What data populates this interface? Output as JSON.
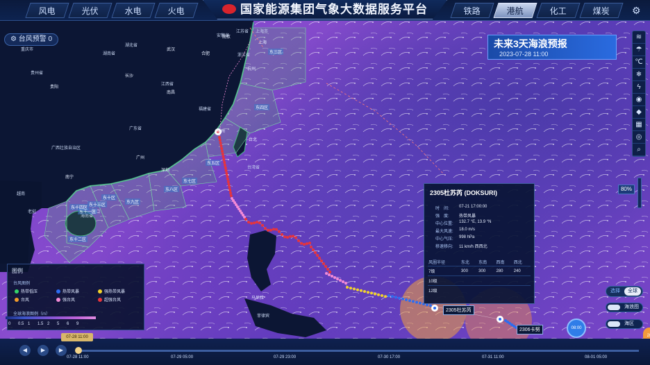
{
  "app": {
    "title": "国家能源集团气象大数据服务平台",
    "left_tabs": [
      "风电",
      "光伏",
      "水电",
      "火电"
    ],
    "right_tabs": [
      "铁路",
      "港航",
      "化工",
      "煤炭"
    ],
    "active_tab": "港航"
  },
  "alerts": {
    "typhoon_warning": "台风预警 0"
  },
  "forecast": {
    "title": "未来3天海浪预报",
    "time": "2023-07-28 11:00"
  },
  "toolbar": {
    "icons": [
      "wind-icon",
      "rain-icon",
      "temperature-icon",
      "snow-icon",
      "lightning-icon",
      "fire-icon",
      "layers-icon",
      "grid-icon",
      "target-icon",
      "search-icon"
    ],
    "zoom_label": "80%"
  },
  "map_labels": {
    "provinces": [
      "重庆市",
      "贵州省",
      "湖南省",
      "湖北省",
      "江西省",
      "广西壮族自治区",
      "广东省",
      "福建省",
      "浙江省",
      "海南省",
      "安徽省",
      "江苏省",
      "上海市",
      "台湾省"
    ],
    "cities": [
      "贵阳",
      "长沙",
      "南昌",
      "福州",
      "台北",
      "广州",
      "深圳",
      "南宁",
      "海口",
      "杭州",
      "合肥",
      "南京",
      "上海",
      "武汉",
      "马尼拉"
    ],
    "countries": [
      "越南",
      "老挝",
      "菲律宾"
    ],
    "sea_zones": [
      "东三区",
      "东四区",
      "东五区",
      "东七区",
      "东八区",
      "东九区",
      "东十区",
      "东十一区",
      "东十二区",
      "东十三区",
      "东十四区"
    ]
  },
  "typhoon_card": {
    "title": "2305杜苏芮 (DOKSURI)",
    "rows": [
      {
        "label": "时　间:",
        "value": "07-21 17:00:00"
      },
      {
        "label": "强　度:",
        "value": "热带风暴"
      },
      {
        "label": "中心位置:",
        "value": "132.7 °E, 13.9 °N"
      },
      {
        "label": "最大风速:",
        "value": "18.0 m/s"
      },
      {
        "label": "中心气压:",
        "value": "998 hPa"
      },
      {
        "label": "移速移向:",
        "value": "11 km/h 西西北"
      }
    ],
    "wind_table": {
      "headers": [
        "风圈半径",
        "东北",
        "东南",
        "西南",
        "西北"
      ],
      "rows": [
        [
          "7级",
          "300",
          "300",
          "280",
          "240"
        ],
        [
          "10级",
          "",
          "",
          "",
          ""
        ],
        [
          "12级",
          "",
          "",
          "",
          ""
        ]
      ]
    }
  },
  "typhoon_labels": {
    "primary": "2305杜苏芮",
    "secondary": "2306卡努"
  },
  "legend": {
    "title": "图例",
    "section1": "台风图例",
    "items": [
      {
        "label": "热带低压",
        "color": "#34d36a"
      },
      {
        "label": "热带风暴",
        "color": "#2d6cf0"
      },
      {
        "label": "强热带风暴",
        "color": "#f2d32b"
      },
      {
        "label": "台风",
        "color": "#f29b2b"
      },
      {
        "label": "强台风",
        "color": "#f28ad6"
      },
      {
        "label": "超强台风",
        "color": "#e8333a"
      }
    ],
    "section2": "全球海浪图例（m）",
    "wave_scale": [
      "0",
      "0.5",
      "1",
      "1.5",
      "2",
      "5",
      "6",
      "9"
    ]
  },
  "toggles": {
    "mode_a": "选择",
    "mode_b": "全球",
    "switch1": "海浪图",
    "switch2": "海区"
  },
  "playback": {
    "badge": "08:00",
    "orb": "28"
  },
  "timeline": {
    "current": "07-28 11:00",
    "labels": [
      "07-28 11:00",
      "07-29 05:00",
      "07-29 23:00",
      "07-30 17:00",
      "07-31 11:00",
      "08-01 05:00"
    ],
    "progress": 0.0
  },
  "colors": {
    "accent": "#2a6be0",
    "track_red": "#e8333a",
    "track_pink": "#f28ad6"
  }
}
